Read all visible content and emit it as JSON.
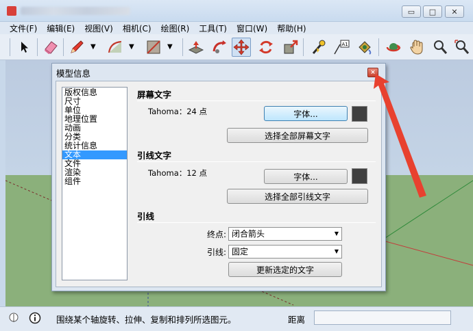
{
  "menu": [
    "文件(F)",
    "编辑(E)",
    "视图(V)",
    "相机(C)",
    "绘图(R)",
    "工具(T)",
    "窗口(W)",
    "帮助(H)"
  ],
  "window_controls": {
    "minimize": "▭",
    "maximize": "□",
    "close": "✕"
  },
  "dialog": {
    "title": "模型信息",
    "close_symbol": "×",
    "categories": [
      "版权信息",
      "尺寸",
      "单位",
      "地理位置",
      "动画",
      "分类",
      "统计信息",
      "文本",
      "文件",
      "渲染",
      "组件"
    ],
    "selected_category": "文本",
    "screen_text": {
      "title": "屏幕文字",
      "font_info": "Tahoma：24 点",
      "font_button": "字体...",
      "select_all_button": "选择全部屏幕文字"
    },
    "leader_text": {
      "title": "引线文字",
      "font_info": "Tahoma：12 点",
      "font_button": "字体...",
      "select_all_button": "选择全部引线文字"
    },
    "leader": {
      "title": "引线",
      "endpoint_label": "终点:",
      "endpoint_value": "闭合箭头",
      "leader_label": "引线:",
      "leader_value": "固定",
      "update_button": "更新选定的文字"
    }
  },
  "status": {
    "message": "围绕某个轴旋转、拉伸、复制和排列所选图元。",
    "distance_label": "距离",
    "distance_value": ""
  },
  "colors": {
    "selection": "#3399ff",
    "swatch": "#404040",
    "annotation_arrow": "#e8412f",
    "ground": "#8bb07b",
    "sky": "#c4d4e6"
  }
}
